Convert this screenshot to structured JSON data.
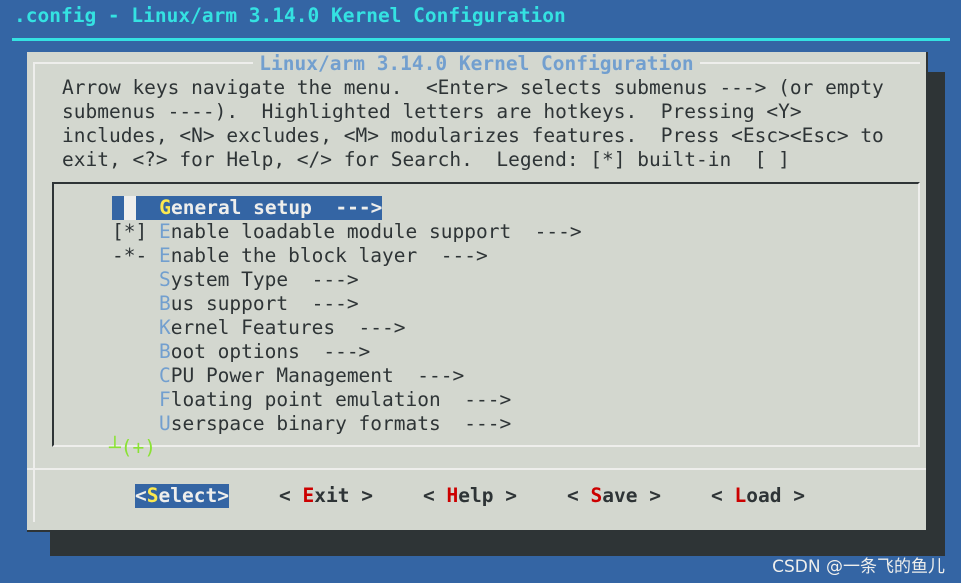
{
  "window_title": ".config - Linux/arm 3.14.0 Kernel Configuration",
  "dialog": {
    "title": "Linux/arm 3.14.0 Kernel Configuration",
    "help_lines": [
      "Arrow keys navigate the menu.  <Enter> selects submenus ---> (or empty",
      "submenus ----).  Highlighted letters are hotkeys.  Pressing <Y>",
      "includes, <N> excludes, <M> modularizes features.  Press <Esc><Esc> to",
      "exit, <?> for Help, </> for Search.  Legend: [*] built-in  [ ]"
    ]
  },
  "menu": {
    "items": [
      {
        "prefix": "    ",
        "hotkey": "G",
        "rest": "eneral setup  --->",
        "selected": true
      },
      {
        "prefix": "[*] ",
        "hotkey": "E",
        "rest": "nable loadable module support  --->"
      },
      {
        "prefix": "-*- ",
        "hotkey": "E",
        "rest": "nable the block layer  --->"
      },
      {
        "prefix": "    ",
        "hotkey": "S",
        "rest": "ystem Type  --->"
      },
      {
        "prefix": "    ",
        "hotkey": "B",
        "rest": "us support  --->"
      },
      {
        "prefix": "    ",
        "hotkey": "K",
        "rest": "ernel Features  --->"
      },
      {
        "prefix": "    ",
        "hotkey": "B",
        "rest": "oot options  --->"
      },
      {
        "prefix": "    ",
        "hotkey": "C",
        "rest": "PU Power Management  --->"
      },
      {
        "prefix": "    ",
        "hotkey": "F",
        "rest": "loating point emulation  --->"
      },
      {
        "prefix": "    ",
        "hotkey": "U",
        "rest": "serspace binary formats  --->"
      }
    ],
    "more_indicator": "┴(+)"
  },
  "buttons": [
    {
      "left": "<",
      "hotkey": "S",
      "rest": "elect",
      "right": ">",
      "selected": true
    },
    {
      "left": "< ",
      "hotkey": "E",
      "rest": "xit",
      "right": " >"
    },
    {
      "left": "< ",
      "hotkey": "H",
      "rest": "elp",
      "right": " >"
    },
    {
      "left": "< ",
      "hotkey": "S",
      "rest": "ave",
      "right": " >"
    },
    {
      "left": "< ",
      "hotkey": "L",
      "rest": "oad",
      "right": " >"
    }
  ],
  "watermark": "CSDN @一条飞的鱼儿",
  "colors": {
    "background": "#3465a4",
    "dialog": "#d3d7cf",
    "title": "#34e2e2",
    "hotkey": "#729fcf",
    "button_hotkey": "#cc0000",
    "selected_hotkey": "#fce94f"
  }
}
